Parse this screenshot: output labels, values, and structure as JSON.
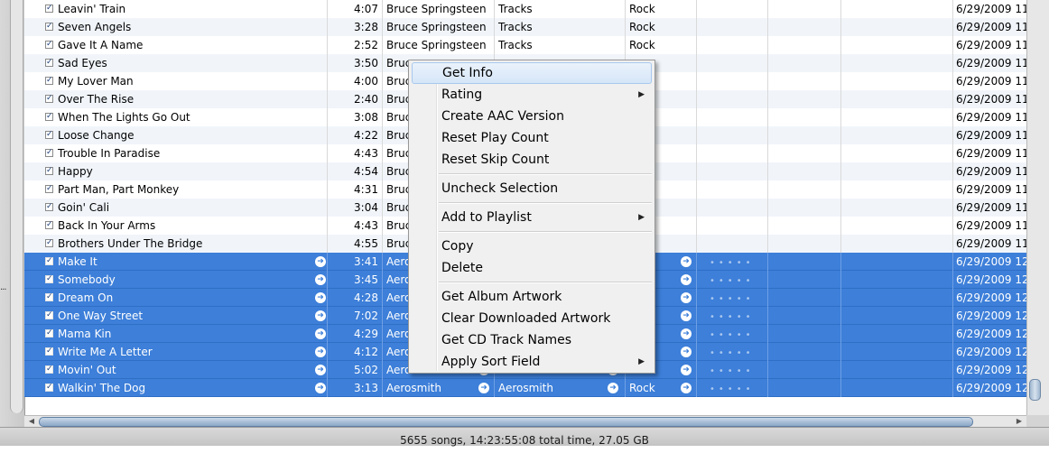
{
  "tracks": [
    {
      "name": "Leavin' Train",
      "time": "4:07",
      "artist": "Bruce Springsteen",
      "album": "Tracks",
      "genre": "Rock",
      "date": "6/29/2009 11",
      "selected": false
    },
    {
      "name": "Seven Angels",
      "time": "3:28",
      "artist": "Bruce Springsteen",
      "album": "Tracks",
      "genre": "Rock",
      "date": "6/29/2009 11",
      "selected": false
    },
    {
      "name": "Gave It A Name",
      "time": "2:52",
      "artist": "Bruce Springsteen",
      "album": "Tracks",
      "genre": "Rock",
      "date": "6/29/2009 11",
      "selected": false
    },
    {
      "name": "Sad Eyes",
      "time": "3:50",
      "artist": "Bruc",
      "album": "",
      "genre": "",
      "date": "6/29/2009 11",
      "selected": false
    },
    {
      "name": "My Lover Man",
      "time": "4:00",
      "artist": "Bruc",
      "album": "",
      "genre": "",
      "date": "6/29/2009 11",
      "selected": false
    },
    {
      "name": "Over The Rise",
      "time": "2:40",
      "artist": "Bruc",
      "album": "",
      "genre": "",
      "date": "6/29/2009 11",
      "selected": false
    },
    {
      "name": "When The Lights Go Out",
      "time": "3:08",
      "artist": "Bruc",
      "album": "",
      "genre": "",
      "date": "6/29/2009 11",
      "selected": false
    },
    {
      "name": "Loose Change",
      "time": "4:22",
      "artist": "Bruc",
      "album": "",
      "genre": "",
      "date": "6/29/2009 11",
      "selected": false
    },
    {
      "name": "Trouble In Paradise",
      "time": "4:43",
      "artist": "Bruc",
      "album": "",
      "genre": "",
      "date": "6/29/2009 11",
      "selected": false
    },
    {
      "name": "Happy",
      "time": "4:54",
      "artist": "Bruc",
      "album": "",
      "genre": "",
      "date": "6/29/2009 11",
      "selected": false
    },
    {
      "name": "Part Man, Part Monkey",
      "time": "4:31",
      "artist": "Bruc",
      "album": "",
      "genre": "",
      "date": "6/29/2009 11",
      "selected": false
    },
    {
      "name": "Goin' Cali",
      "time": "3:04",
      "artist": "Bruc",
      "album": "",
      "genre": "",
      "date": "6/29/2009 11",
      "selected": false
    },
    {
      "name": "Back In Your Arms",
      "time": "4:43",
      "artist": "Bruc",
      "album": "",
      "genre": "",
      "date": "6/29/2009 11",
      "selected": false
    },
    {
      "name": "Brothers Under The Bridge",
      "time": "4:55",
      "artist": "Bruc",
      "album": "",
      "genre": "",
      "date": "6/29/2009 11",
      "selected": false
    },
    {
      "name": "Make It",
      "time": "3:41",
      "artist": "Aero",
      "album": "",
      "genre": "",
      "date": "6/29/2009 12",
      "selected": true
    },
    {
      "name": "Somebody",
      "time": "3:45",
      "artist": "Aero",
      "album": "",
      "genre": "",
      "date": "6/29/2009 12",
      "selected": true
    },
    {
      "name": "Dream On",
      "time": "4:28",
      "artist": "Aero",
      "album": "",
      "genre": "",
      "date": "6/29/2009 12",
      "selected": true
    },
    {
      "name": "One Way Street",
      "time": "7:02",
      "artist": "Aero",
      "album": "",
      "genre": "",
      "date": "6/29/2009 12",
      "selected": true
    },
    {
      "name": "Mama Kin",
      "time": "4:29",
      "artist": "Aero",
      "album": "",
      "genre": "",
      "date": "6/29/2009 12",
      "selected": true
    },
    {
      "name": "Write Me A Letter",
      "time": "4:12",
      "artist": "Aero",
      "album": "",
      "genre": "",
      "date": "6/29/2009 12",
      "selected": true
    },
    {
      "name": "Movin' Out",
      "time": "5:02",
      "artist": "Aerosmith",
      "album": "Aerosmith",
      "genre": "Rock",
      "date": "6/29/2009 12",
      "selected": true
    },
    {
      "name": "Walkin' The Dog",
      "time": "3:13",
      "artist": "Aerosmith",
      "album": "Aerosmith",
      "genre": "Rock",
      "date": "6/29/2009 12",
      "selected": true
    }
  ],
  "context_menu": {
    "items": [
      {
        "label": "Get Info",
        "submenu": false,
        "highlighted": true
      },
      {
        "label": "Rating",
        "submenu": true
      },
      {
        "label": "Create AAC Version",
        "submenu": false
      },
      {
        "label": "Reset Play Count",
        "submenu": false
      },
      {
        "label": "Reset Skip Count",
        "submenu": false
      },
      {
        "label": "Uncheck Selection",
        "submenu": false
      },
      {
        "label": "Add to Playlist",
        "submenu": true
      },
      {
        "label": "Copy",
        "submenu": false
      },
      {
        "label": "Delete",
        "submenu": false
      },
      {
        "label": "Get Album Artwork",
        "submenu": false
      },
      {
        "label": "Clear Downloaded Artwork",
        "submenu": false
      },
      {
        "label": "Get CD Track Names",
        "submenu": false
      },
      {
        "label": "Apply Sort Field",
        "submenu": true
      }
    ]
  },
  "status": {
    "summary": "5655 songs, 14:23:55:08 total time, 27.05 GB"
  },
  "colors": {
    "selection": "#3d7fd9",
    "row_alt": "#f1f5fa",
    "menu_bg": "#f0f0f0"
  },
  "icons": {
    "check": "checkbox-checked-icon",
    "go_arrow": "arrow-link-icon",
    "submenu": "submenu-arrow-icon"
  }
}
